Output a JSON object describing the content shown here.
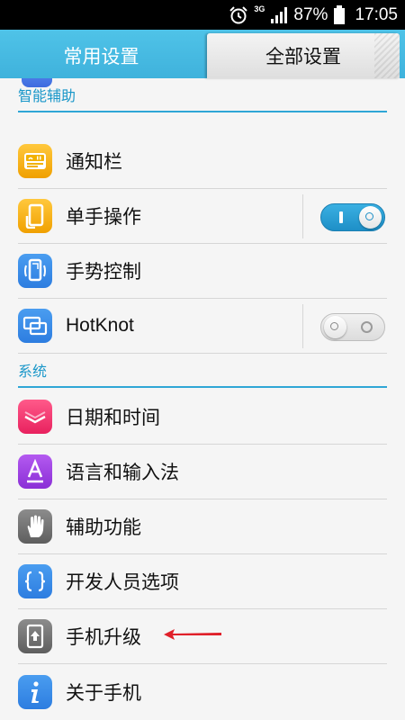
{
  "status_bar": {
    "network": "3G",
    "battery_percent": "87%",
    "time": "17:05"
  },
  "tabs": [
    {
      "label": "常用设置",
      "selected": false
    },
    {
      "label": "全部设置",
      "selected": true
    }
  ],
  "sections": {
    "smart": {
      "header": "智能辅助",
      "items": [
        {
          "label": "通知栏",
          "icon": "notification-bar-icon"
        },
        {
          "label": "单手操作",
          "icon": "one-hand-icon",
          "toggle": "on"
        },
        {
          "label": "手势控制",
          "icon": "gesture-icon"
        },
        {
          "label": "HotKnot",
          "icon": "hotknot-icon",
          "toggle": "off"
        }
      ]
    },
    "system": {
      "header": "系统",
      "items": [
        {
          "label": "日期和时间",
          "icon": "clock-icon"
        },
        {
          "label": "语言和输入法",
          "icon": "language-icon"
        },
        {
          "label": "辅助功能",
          "icon": "hand-icon"
        },
        {
          "label": "开发人员选项",
          "icon": "braces-icon"
        },
        {
          "label": "手机升级",
          "icon": "update-icon"
        },
        {
          "label": "关于手机",
          "icon": "info-icon"
        }
      ]
    }
  },
  "colors": {
    "accent": "#1a97c9",
    "tab_bar": "#4fc3e8",
    "annotation_arrow": "#e0202a"
  }
}
